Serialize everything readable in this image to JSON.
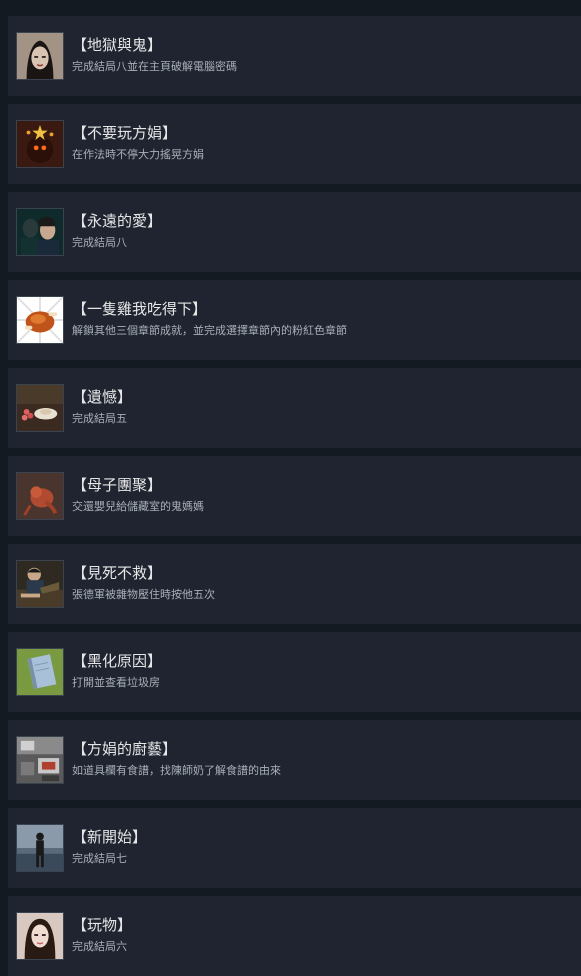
{
  "achievements": [
    {
      "title": "【地獄與鬼】",
      "desc": "完成結局八並在主頁破解電腦密碼",
      "icon": "portrait-ghost-woman-icon"
    },
    {
      "title": "【不要玩方娟】",
      "desc": "在作法時不停大力搖晃方娟",
      "icon": "demon-doll-icon"
    },
    {
      "title": "【永遠的愛】",
      "desc": "完成結局八",
      "icon": "couple-portrait-icon"
    },
    {
      "title": "【一隻雞我吃得下】",
      "desc": "解鎖其他三個章節成就，並完成選擇章節內的粉紅色章節",
      "icon": "roast-chicken-icon"
    },
    {
      "title": "【遺憾】",
      "desc": "完成結局五",
      "icon": "cake-plate-icon"
    },
    {
      "title": "【母子團聚】",
      "desc": "交還嬰兒給儲藏室的鬼媽媽",
      "icon": "baby-icon"
    },
    {
      "title": "【見死不救】",
      "desc": "張德軍被雜物壓住時按他五次",
      "icon": "man-pinned-icon"
    },
    {
      "title": "【黑化原因】",
      "desc": "打開並查看垃圾房",
      "icon": "notebook-icon"
    },
    {
      "title": "【方娟的廚藝】",
      "desc": "如道具欄有食譜，找陳師奶了解食譜的由來",
      "icon": "kitchen-icon"
    },
    {
      "title": "【新開始】",
      "desc": "完成結局七",
      "icon": "person-walking-icon"
    },
    {
      "title": "【玩物】",
      "desc": "完成結局六",
      "icon": "portrait-woman-icon"
    }
  ]
}
